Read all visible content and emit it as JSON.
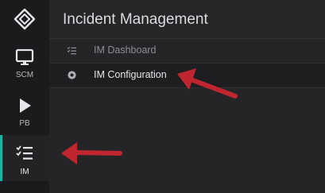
{
  "header": {
    "title": "Incident Management"
  },
  "rail": {
    "logo": "diamond-logo-icon",
    "items": [
      {
        "label": "SCM",
        "icon": "monitor-icon"
      },
      {
        "label": "PB",
        "icon": "play-icon"
      },
      {
        "label": "IM",
        "icon": "checklist-icon",
        "active": true
      }
    ]
  },
  "nav": {
    "items": [
      {
        "label": "IM Dashboard",
        "icon": "checklist-icon"
      },
      {
        "label": "IM Configuration",
        "icon": "gear-icon",
        "active": true
      }
    ]
  },
  "colors": {
    "accent": "#16b6a6",
    "annotation_arrow": "#c0262f"
  }
}
